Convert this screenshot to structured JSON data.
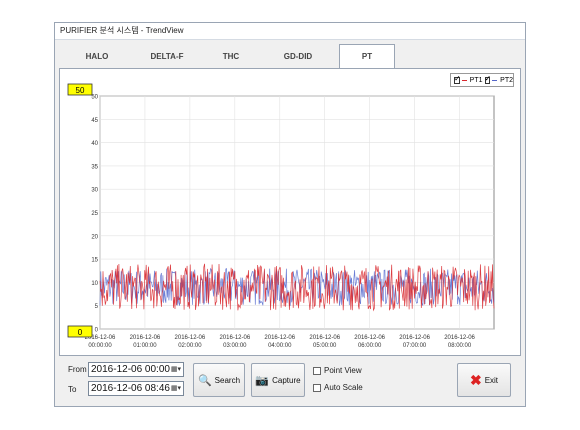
{
  "window": {
    "title": "PURIFIER 분석 시스템 - TrendView"
  },
  "tabs": [
    {
      "label": "HALO",
      "active": false
    },
    {
      "label": "DELTA-F",
      "active": false
    },
    {
      "label": "THC",
      "active": false
    },
    {
      "label": "GD-DID",
      "active": false
    },
    {
      "label": "PT",
      "active": true
    }
  ],
  "legend": [
    {
      "name": "PT1",
      "checked": true,
      "color": "#d8282e"
    },
    {
      "name": "PT2",
      "checked": true,
      "color": "#5566c8"
    }
  ],
  "scale": {
    "max_badge": "50",
    "min_badge": "0"
  },
  "chart_data": {
    "type": "line",
    "ylim": [
      0,
      50
    ],
    "yticks": [
      "0",
      "5",
      "10",
      "15",
      "20",
      "25",
      "30",
      "35",
      "40",
      "45",
      "50"
    ],
    "xticks": [
      [
        "2016-12-06",
        "00:00:00"
      ],
      [
        "2016-12-06",
        "01:00:00"
      ],
      [
        "2016-12-06",
        "02:00:00"
      ],
      [
        "2016-12-06",
        "03:00:00"
      ],
      [
        "2016-12-06",
        "04:00:00"
      ],
      [
        "2016-12-06",
        "05:00:00"
      ],
      [
        "2016-12-06",
        "06:00:00"
      ],
      [
        "2016-12-06",
        "07:00:00"
      ],
      [
        "2016-12-06",
        "08:00:00"
      ]
    ],
    "x_end": "2016-12-06 08:46",
    "series": [
      {
        "name": "PT1",
        "color": "#d8282e",
        "band": [
          4,
          14
        ]
      },
      {
        "name": "PT2",
        "color": "#5a6fd0",
        "band": [
          5,
          13
        ]
      }
    ]
  },
  "filters": {
    "from_label": "From",
    "to_label": "To",
    "from_value": "2016-12-06 00:00",
    "to_value": "2016-12-06 08:46"
  },
  "buttons": {
    "search": "Search",
    "capture": "Capture",
    "exit": "Exit"
  },
  "options": {
    "point_view": "Point View",
    "auto_scale": "Auto Scale"
  }
}
